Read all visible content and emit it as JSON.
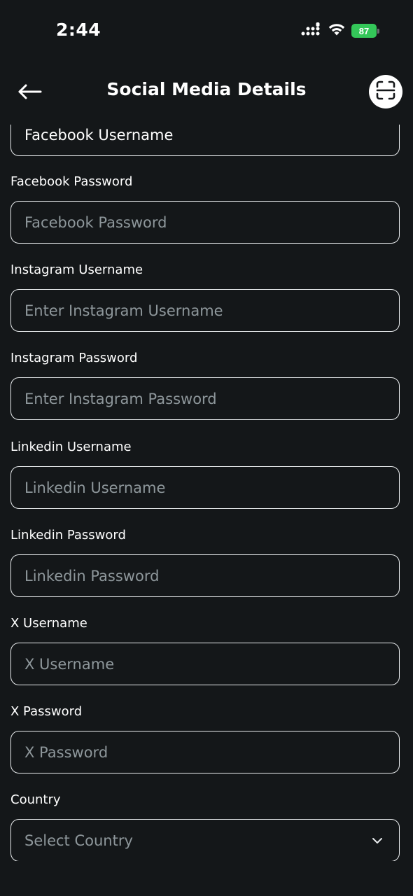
{
  "status_bar": {
    "time": "2:44",
    "battery": "87"
  },
  "header": {
    "title": "Social Media Details",
    "back_icon": "arrow-left-icon",
    "scan_icon": "scan-icon"
  },
  "form": {
    "facebook_username": {
      "value": "Facebook Username"
    },
    "facebook_password": {
      "label": "Facebook Password",
      "placeholder": "Facebook Password"
    },
    "instagram_username": {
      "label": "Instagram Username",
      "placeholder": "Enter Instagram Username"
    },
    "instagram_password": {
      "label": "Instagram Password",
      "placeholder": "Enter Instagram Password"
    },
    "linkedin_username": {
      "label": "Linkedin Username",
      "placeholder": "Linkedin Username"
    },
    "linkedin_password": {
      "label": "Linkedin Password",
      "placeholder": "Linkedin Password"
    },
    "x_username": {
      "label": "X Username",
      "placeholder": "X Username"
    },
    "x_password": {
      "label": "X Password",
      "placeholder": "X Password"
    },
    "country": {
      "label": "Country",
      "placeholder": "Select Country"
    }
  },
  "colors": {
    "background": "#141719",
    "text": "#ffffff",
    "placeholder": "#8e979b",
    "border": "#e9ecee",
    "battery": "#34c759"
  }
}
